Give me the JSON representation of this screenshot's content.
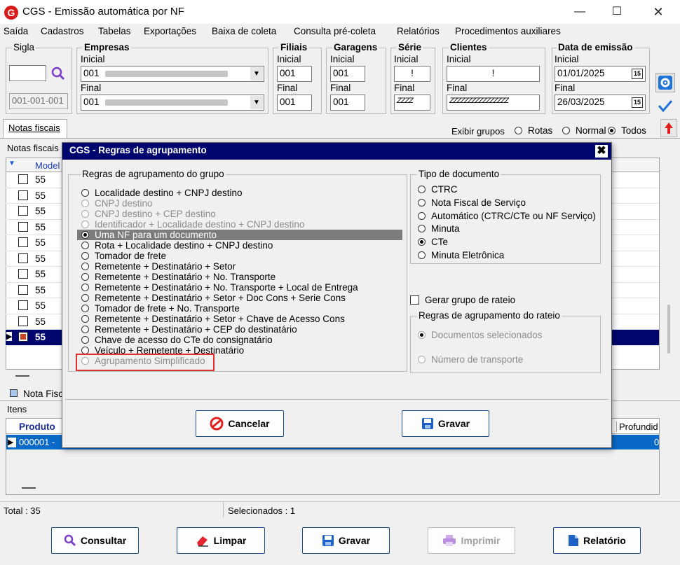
{
  "window": {
    "title": "CGS - Emissão automática por NF"
  },
  "menu": [
    "Saída",
    "Cadastros",
    "Tabelas",
    "Exportações",
    "Baixa de coleta",
    "Consulta pré-coleta",
    "Relatórios",
    "Procedimentos auxiliares"
  ],
  "filters": {
    "sigla": {
      "title": "Sigla",
      "value": "",
      "code": "001-001-001"
    },
    "empresas": {
      "title": "Empresas",
      "inicial_label": "Inicial",
      "final_label": "Final",
      "inicial": "001",
      "final": "001"
    },
    "filiais": {
      "title": "Filiais",
      "inicial_label": "Inicial",
      "final_label": "Final",
      "inicial": "001",
      "final": "001"
    },
    "garagens": {
      "title": "Garagens",
      "inicial_label": "Inicial",
      "final_label": "Final",
      "inicial": "001",
      "final": "001"
    },
    "serie": {
      "title": "Série",
      "inicial_label": "Inicial",
      "final_label": "Final",
      "inicial": "!",
      "final": "ZZZZ"
    },
    "clientes": {
      "title": "Clientes",
      "inicial_label": "Inicial",
      "final_label": "Final",
      "inicial": "!",
      "final": "ZZZZZZZZZZZZZZZZ"
    },
    "data_emissao": {
      "title": "Data de emissão",
      "inicial_label": "Inicial",
      "final_label": "Final",
      "inicial": "01/01/2025",
      "final": "26/03/2025",
      "cal": "15"
    }
  },
  "tabs": {
    "notas": "Notas fiscais"
  },
  "exibir": {
    "label": "Exibir grupos",
    "options": [
      "Rotas",
      "Normal",
      "Todos"
    ],
    "selected": "Todos"
  },
  "grid": {
    "caption": "Notas fiscais",
    "header": "Model",
    "rows": [
      "55",
      "55",
      "55",
      "55",
      "55",
      "55",
      "55",
      "55",
      "55",
      "55",
      "55"
    ],
    "selected_row": 10
  },
  "nota_fisc_label": "Nota Fisc",
  "itens": {
    "label": "Itens",
    "col_produto": "Produto",
    "col_profund": "Profundid",
    "row_value": "000001 - ",
    "row_end": "0"
  },
  "status": {
    "total": "Total : 35",
    "selecionados": "Selecionados : 1"
  },
  "buttons": {
    "consultar": "Consultar",
    "limpar": "Limpar",
    "gravar": "Gravar",
    "imprimir": "Imprimir",
    "relatorio": "Relatório"
  },
  "dialog": {
    "title": "CGS - Regras de agrupamento",
    "group_rules_title": "Regras de agrupamento do grupo",
    "rules": [
      {
        "label": "Localidade destino + CNPJ destino",
        "state": "normal"
      },
      {
        "label": "CNPJ destino",
        "state": "disabled"
      },
      {
        "label": "CNPJ destino + CEP destino",
        "state": "disabled"
      },
      {
        "label": "Identificador + Localidade destino + CNPJ destino",
        "state": "disabled"
      },
      {
        "label": "Uma NF para um documento",
        "state": "selected"
      },
      {
        "label": "Rota + Localidade destino + CNPJ destino",
        "state": "normal"
      },
      {
        "label": "Tomador de frete",
        "state": "normal"
      },
      {
        "label": "Remetente + Destinatário + Setor",
        "state": "normal"
      },
      {
        "label": "Remetente + Destinatário + No. Transporte",
        "state": "normal"
      },
      {
        "label": "Remetente + Destinatário + No. Transporte + Local de Entrega",
        "state": "normal"
      },
      {
        "label": "Remetente + Destinatário + Setor + Doc Cons + Serie Cons",
        "state": "normal"
      },
      {
        "label": "Tomador de frete + No. Transporte",
        "state": "normal"
      },
      {
        "label": "Remetente + Destinatário + Setor + Chave de Acesso Cons",
        "state": "normal"
      },
      {
        "label": "Remetente + Destinatário + CEP do destinatário",
        "state": "normal"
      },
      {
        "label": "Chave de acesso do CTe do consignatário",
        "state": "normal"
      },
      {
        "label": "Veículo + Remetente + Destinatário",
        "state": "normal"
      },
      {
        "label": "Agrupamento Simplificado",
        "state": "disabled"
      }
    ],
    "doc_type_title": "Tipo de documento",
    "doc_types": [
      "CTRC",
      "Nota Fiscal de Serviço",
      "Automático (CTRC/CTe ou NF Serviço)",
      "Minuta",
      "CTe",
      "Minuta Eletrônica"
    ],
    "doc_type_selected": 4,
    "gerar_rateio": "Gerar grupo de rateio",
    "rateio_title": "Regras de agrupamento do rateio",
    "rateio_options": [
      "Documentos selecionados",
      "Número de transporte"
    ],
    "cancel": "Cancelar",
    "save": "Gravar",
    "highlight_color": "#e03030"
  }
}
